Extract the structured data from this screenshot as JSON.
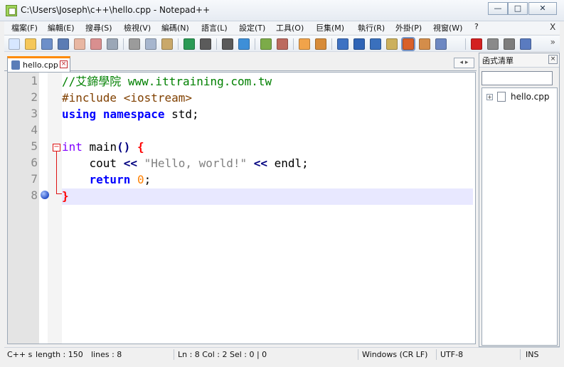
{
  "window": {
    "title": "C:\\Users\\Joseph\\c++\\hello.cpp - Notepad++",
    "controls": {
      "minimize": "—",
      "maximize": "□",
      "close": "✕"
    }
  },
  "menu": {
    "items": [
      "檔案(F)",
      "編輯(E)",
      "搜尋(S)",
      "檢視(V)",
      "編碼(N)",
      "語言(L)",
      "設定(T)",
      "工具(O)",
      "巨集(M)",
      "執行(R)",
      "外掛(P)",
      "視窗(W)",
      "?"
    ],
    "close": "X"
  },
  "toolbar": {
    "icons": [
      "new-file-icon",
      "open-file-icon",
      "save-icon",
      "save-all-icon",
      "close-icon",
      "close-all-icon",
      "print-icon",
      "cut-icon",
      "copy-icon",
      "paste-icon",
      "undo-icon",
      "redo-icon",
      "find-icon",
      "replace-icon",
      "zoom-in-icon",
      "zoom-out-icon",
      "sync-vertical-icon",
      "sync-horizontal-icon",
      "word-wrap-icon",
      "show-all-characters-icon",
      "indent-guide-icon",
      "document-map-icon",
      "function-list-icon",
      "folder-as-workspace-icon",
      "monitoring-icon",
      "record-macro-icon",
      "stop-macro-icon",
      "playback-macro-icon",
      "run-macro-multiple-icon"
    ],
    "more": "»"
  },
  "tabs": [
    {
      "label": "hello.cpp",
      "close": "×"
    }
  ],
  "tab_nav": "◂ ▸",
  "editor": {
    "line_numbers": [
      "1",
      "2",
      "3",
      "4",
      "5",
      "6",
      "7",
      "8"
    ],
    "lines": [
      [
        {
          "t": "//艾鍗學院 www.ittraining.com.tw",
          "c": "comment"
        }
      ],
      [
        {
          "t": "#include <iostream>",
          "c": "pre"
        }
      ],
      [
        {
          "t": "using",
          "c": "kw"
        },
        {
          "t": " ",
          "c": "id"
        },
        {
          "t": "namespace",
          "c": "kw"
        },
        {
          "t": " std;",
          "c": "id"
        }
      ],
      [],
      [
        {
          "t": "int",
          "c": "type"
        },
        {
          "t": " main",
          "c": "id"
        },
        {
          "t": "()",
          "c": "op"
        },
        {
          "t": " ",
          "c": "id"
        },
        {
          "t": "{",
          "c": "brace"
        }
      ],
      [
        {
          "t": "    cout ",
          "c": "id"
        },
        {
          "t": "<<",
          "c": "op"
        },
        {
          "t": " ",
          "c": "id"
        },
        {
          "t": "\"Hello, world!\"",
          "c": "str"
        },
        {
          "t": " ",
          "c": "id"
        },
        {
          "t": "<<",
          "c": "op"
        },
        {
          "t": " endl;",
          "c": "id"
        }
      ],
      [
        {
          "t": "    ",
          "c": "id"
        },
        {
          "t": "return",
          "c": "kw"
        },
        {
          "t": " ",
          "c": "id"
        },
        {
          "t": "0",
          "c": "num"
        },
        {
          "t": ";",
          "c": "id"
        }
      ],
      [
        {
          "t": "}",
          "c": "brace"
        }
      ]
    ],
    "fold_toggle": "−"
  },
  "panel": {
    "title": "函式清單",
    "close": "×",
    "search_value": "",
    "tree": {
      "expander": "+",
      "label": "hello.cpp"
    }
  },
  "status": {
    "language": "C++ s",
    "length": "length : 150",
    "lines": "lines : 8",
    "position": "Ln : 8    Col : 2    Sel : 0 | 0",
    "eol": "Windows (CR LF)",
    "encoding": "UTF-8",
    "mode": "INS"
  }
}
